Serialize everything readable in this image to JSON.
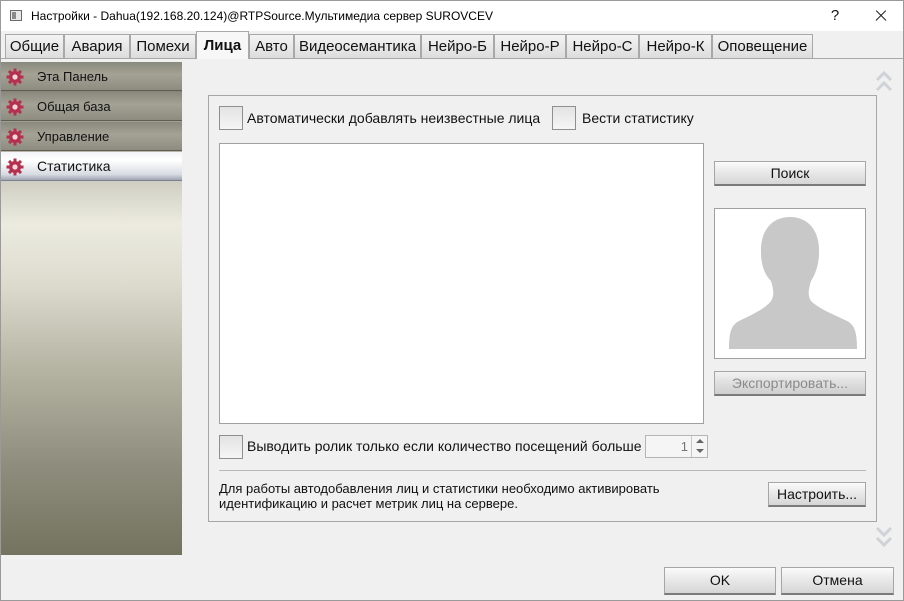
{
  "window": {
    "title": "Настройки - Dahua(192.168.20.124)@RTPSource.Мультимедиа сервер SUROVCEV",
    "help_label": "?"
  },
  "tabs": [
    {
      "label": "Общие"
    },
    {
      "label": "Авария"
    },
    {
      "label": "Помехи"
    },
    {
      "label": "Лица",
      "active": true
    },
    {
      "label": "Авто"
    },
    {
      "label": "Видеосемантика"
    },
    {
      "label": "Нейро-Б"
    },
    {
      "label": "Нейро-Р"
    },
    {
      "label": "Нейро-С"
    },
    {
      "label": "Нейро-К"
    },
    {
      "label": "Оповещение"
    }
  ],
  "sidebar": {
    "items": [
      {
        "label": "Эта Панель",
        "icon": "gear-icon"
      },
      {
        "label": "Общая база",
        "icon": "gear-icon"
      },
      {
        "label": "Управление",
        "icon": "gear-icon"
      },
      {
        "label": "Статистика",
        "icon": "gear-icon",
        "active": true
      }
    ]
  },
  "faces": {
    "auto_add_label": "Автоматически добавлять неизвестные лица",
    "auto_add_checked": false,
    "stats_label": "Вести статистику",
    "stats_checked": false,
    "search_button": "Поиск",
    "export_button": "Экспортировать...",
    "clip_label": "Выводить ролик только если количество посещений больше",
    "clip_checked": false,
    "visits_value": "1",
    "info_text_line1": "Для работы автодобавления лиц и статистики необходимо активировать",
    "info_text_line2": "идентификацию и расчет метрик лиц на сервере.",
    "configure_button": "Настроить..."
  },
  "footer": {
    "ok_button": "OK",
    "cancel_button": "Отмена"
  },
  "colors": {
    "gear_icon": "#b5304f",
    "sidebar_dark": "#6d6b62",
    "sidebar_light": "#ecebe0"
  }
}
